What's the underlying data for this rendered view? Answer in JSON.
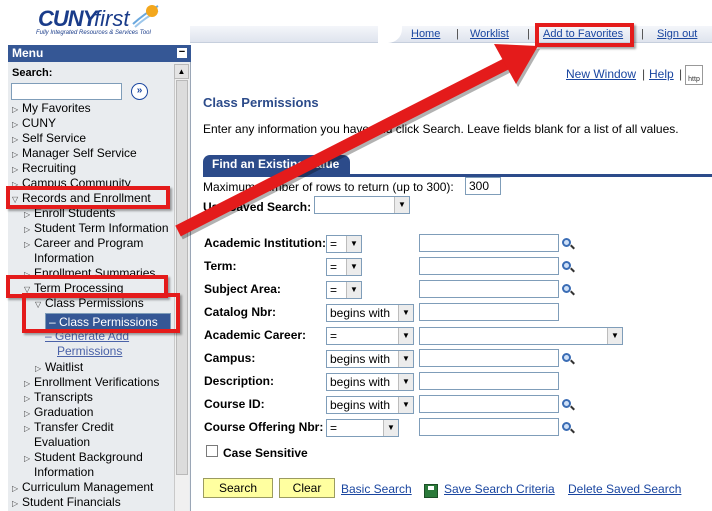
{
  "header": {
    "logo_cuny": "CUNY",
    "logo_first": "first",
    "logo_tagline": "Fully Integrated Resources & Services Tool",
    "links": {
      "home": "Home",
      "worklist": "Worklist",
      "add_favorites": "Add to Favorites",
      "sign_out": "Sign out"
    }
  },
  "sidebar": {
    "title": "Menu",
    "collapse": "−",
    "search_label": "Search:",
    "search_go": "»",
    "items": {
      "my_favorites": "My Favorites",
      "cuny": "CUNY",
      "self_service": "Self Service",
      "manager_self_service": "Manager Self Service",
      "recruiting": "Recruiting",
      "campus_community": "Campus Community",
      "records_enrollment": "Records and Enrollment",
      "enroll_students": "Enroll Students",
      "student_term_info": "Student Term Information",
      "career_program_1": "Career and Program",
      "career_program_2": "Information",
      "enrollment_summaries": "Enrollment Summaries",
      "term_processing": "Term Processing",
      "class_permissions_folder": "Class Permissions",
      "class_permissions_selected": "– Class Permissions",
      "generate_add_1": "– Generate Add",
      "generate_add_2": "Permissions",
      "waitlist": "Waitlist",
      "enrollment_verifications": "Enrollment Verifications",
      "transcripts": "Transcripts",
      "graduation": "Graduation",
      "transfer_credit_1": "Transfer Credit",
      "transfer_credit_2": "Evaluation",
      "student_background_1": "Student Background",
      "student_background_2": "Information",
      "curriculum_management": "Curriculum Management",
      "student_financials": "Student Financials"
    }
  },
  "main": {
    "new_window": "New Window",
    "help": "Help",
    "http_icon": "http",
    "title": "Class Permissions",
    "instructions": "Enter any information you have and click Search. Leave fields blank for a list of all values.",
    "tab": "Find an Existing Value",
    "max_rows_label": "Maximum number of rows to return (up to 300):",
    "max_rows_value": "300",
    "saved_search_label": "Use Saved Search:",
    "fields": {
      "institution": {
        "label": "Academic Institution:",
        "op": "="
      },
      "term": {
        "label": "Term:",
        "op": "="
      },
      "subject": {
        "label": "Subject Area:",
        "op": "="
      },
      "catalog": {
        "label": "Catalog Nbr:",
        "op": "begins with"
      },
      "career": {
        "label": "Academic Career:",
        "op": "="
      },
      "campus": {
        "label": "Campus:",
        "op": "begins with"
      },
      "description": {
        "label": "Description:",
        "op": "begins with"
      },
      "course_id": {
        "label": "Course ID:",
        "op": "begins with"
      },
      "offering": {
        "label": "Course Offering Nbr:",
        "op": "="
      }
    },
    "case_sensitive": "Case Sensitive",
    "buttons": {
      "search": "Search",
      "clear": "Clear"
    },
    "links": {
      "basic_search": "Basic Search",
      "save_criteria": "Save Search Criteria",
      "delete_saved": "Delete Saved Search"
    }
  }
}
